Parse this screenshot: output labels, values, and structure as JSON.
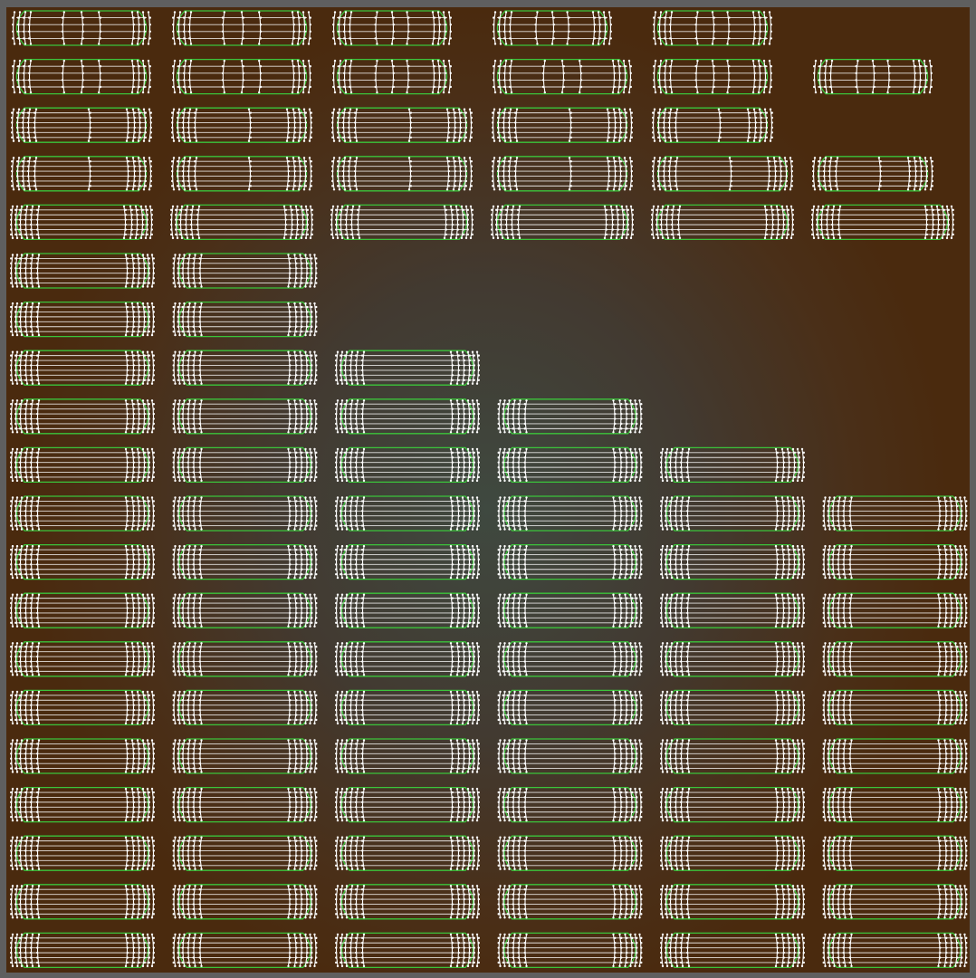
{
  "editor": {
    "view": "uv-editor-viewport",
    "colors": {
      "background_center": "#3f4940",
      "background_edge": "#4a2a0e",
      "frame": "#5f5f5f",
      "island_border": "#3bc43b",
      "uv_edge": "#ffffff",
      "uv_vertex": "#ffffff"
    },
    "islands": {
      "shape": "rounded-slat",
      "rows": [
        {
          "count": 5,
          "style": "sparse"
        },
        {
          "count": 6,
          "style": "sparse"
        },
        {
          "count": 5,
          "style": "mixed"
        },
        {
          "count": 6,
          "style": "mixed"
        },
        {
          "count": 6,
          "style": "dense"
        },
        {
          "count": 2,
          "style": "dense"
        },
        {
          "count": 2,
          "style": "dense"
        },
        {
          "count": 3,
          "style": "dense"
        },
        {
          "count": 4,
          "style": "dense"
        },
        {
          "count": 5,
          "style": "dense"
        },
        {
          "count": 6,
          "style": "dense"
        },
        {
          "count": 6,
          "style": "dense"
        },
        {
          "count": 6,
          "style": "dense"
        },
        {
          "count": 6,
          "style": "dense"
        },
        {
          "count": 6,
          "style": "dense"
        },
        {
          "count": 6,
          "style": "dense"
        },
        {
          "count": 6,
          "style": "dense"
        },
        {
          "count": 6,
          "style": "dense"
        },
        {
          "count": 6,
          "style": "dense"
        },
        {
          "count": 6,
          "style": "dense"
        }
      ]
    }
  }
}
